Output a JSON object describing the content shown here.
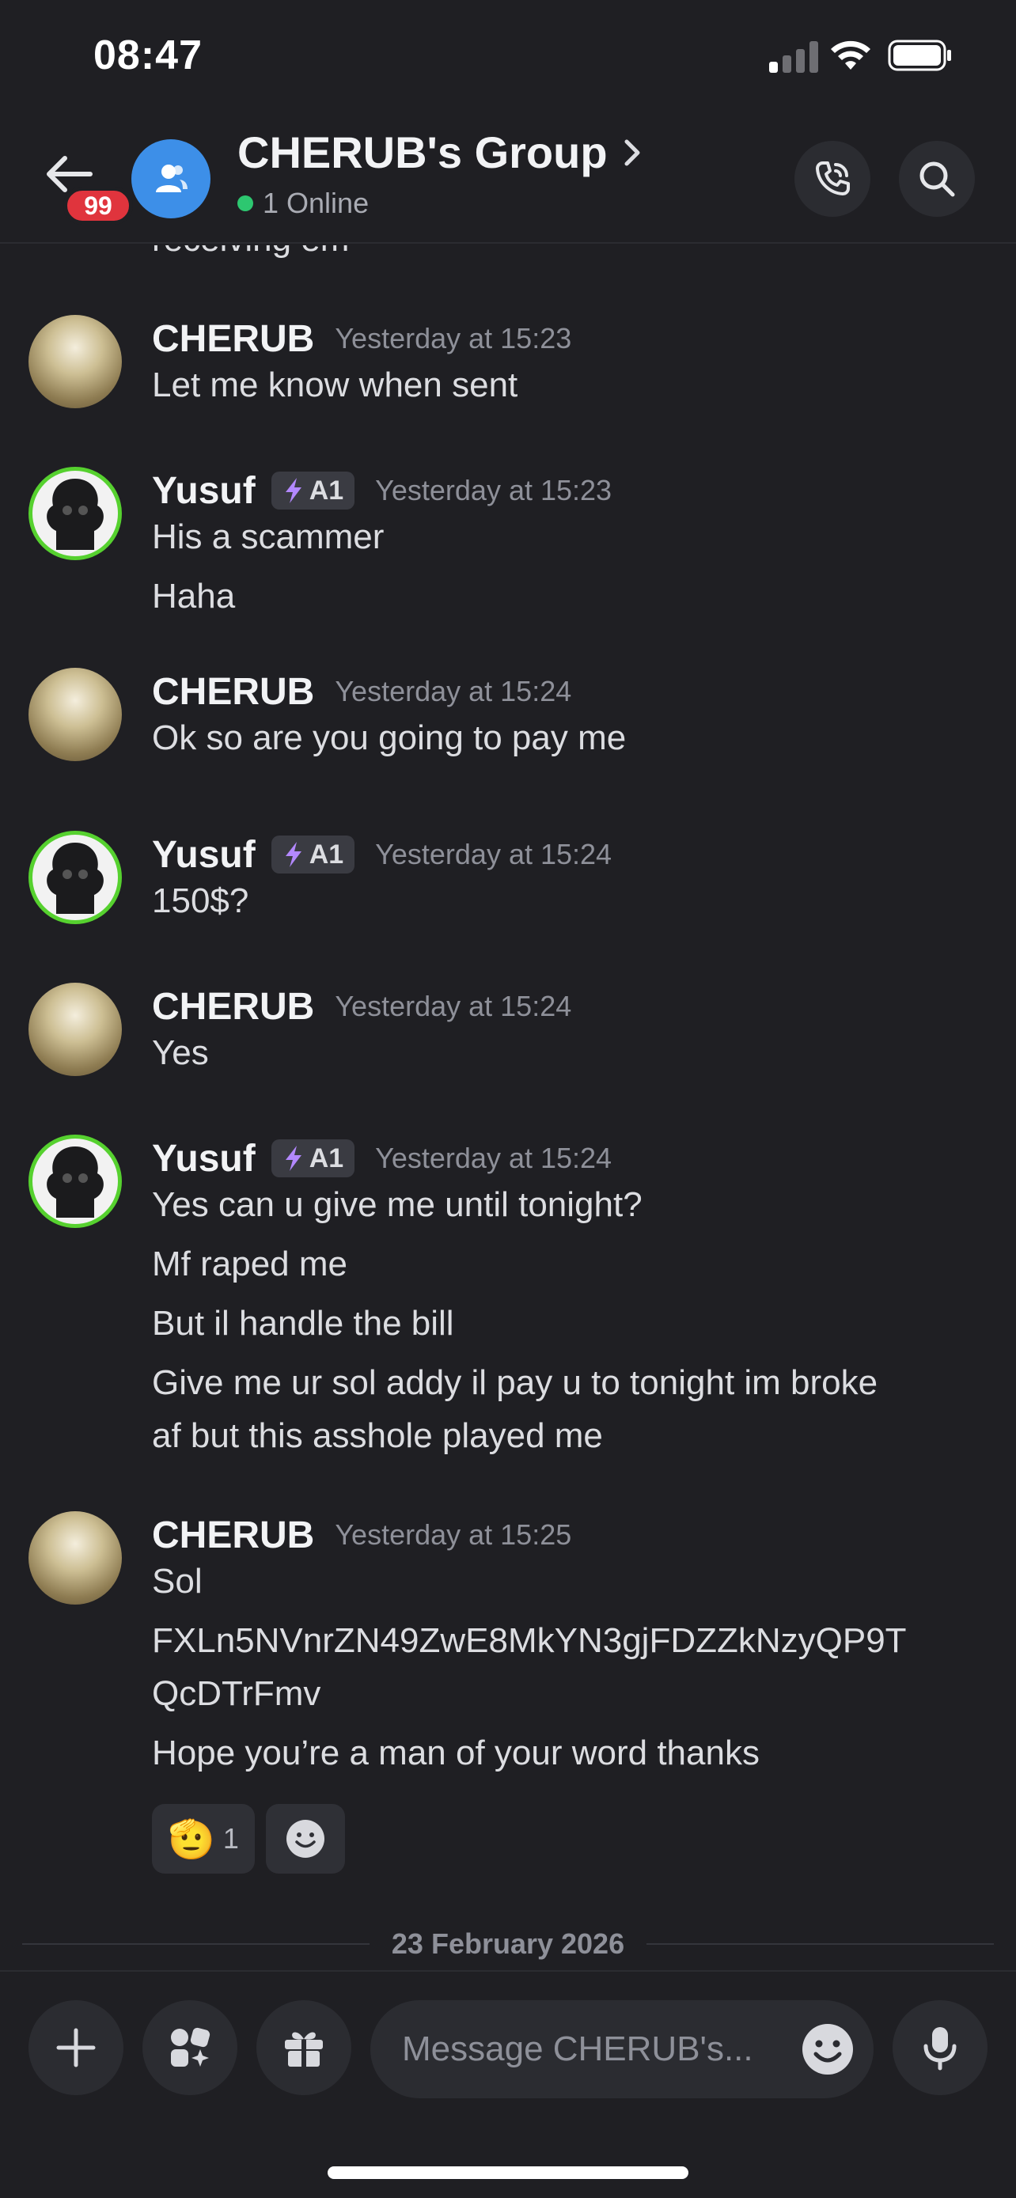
{
  "status_bar": {
    "time": "08:47"
  },
  "header": {
    "unread_badge": "99",
    "group_name": "CHERUB's Group",
    "online_status": "1 Online"
  },
  "messages": {
    "cutoff_text": "receiving em",
    "groups": [
      {
        "author": "CHERUB",
        "timestamp": "Yesterday at 15:23",
        "lines": [
          "Let me know when sent"
        ]
      },
      {
        "author": "Yusuf",
        "tag": "A1",
        "timestamp": "Yesterday at 15:23",
        "lines": [
          "His a scammer",
          "Haha"
        ]
      },
      {
        "author": "CHERUB",
        "timestamp": "Yesterday at 15:24",
        "lines": [
          "Ok so are you going to pay me"
        ]
      },
      {
        "author": "Yusuf",
        "tag": "A1",
        "timestamp": "Yesterday at 15:24",
        "lines": [
          "150$?"
        ]
      },
      {
        "author": "CHERUB",
        "timestamp": "Yesterday at 15:24",
        "lines": [
          "Yes"
        ]
      },
      {
        "author": "Yusuf",
        "tag": "A1",
        "timestamp": "Yesterday at 15:24",
        "lines": [
          "Yes can u give me until tonight?",
          "Mf raped me",
          "But il handle the bill",
          "Give me ur sol addy il pay u to tonight im broke",
          "af but this asshole played me"
        ]
      },
      {
        "author": "CHERUB",
        "timestamp": "Yesterday at 15:25",
        "lines": [
          "Sol",
          "FXLn5NVnrZN49ZwE8MkYN3gjFDZZkNzyQP9T",
          "QcDTrFmv",
          "Hope you’re a man of your word thanks"
        ],
        "reactions": [
          {
            "emoji": "🫡",
            "count": "1"
          }
        ]
      }
    ]
  },
  "date_divider": "23 February 2026",
  "composer": {
    "placeholder": "Message CHERUB's..."
  },
  "colors": {
    "accent_blue": "#3d8fe8",
    "online_green": "#2dc770",
    "badge_red": "#e0343d",
    "yusuf_ring": "#56d12f"
  }
}
